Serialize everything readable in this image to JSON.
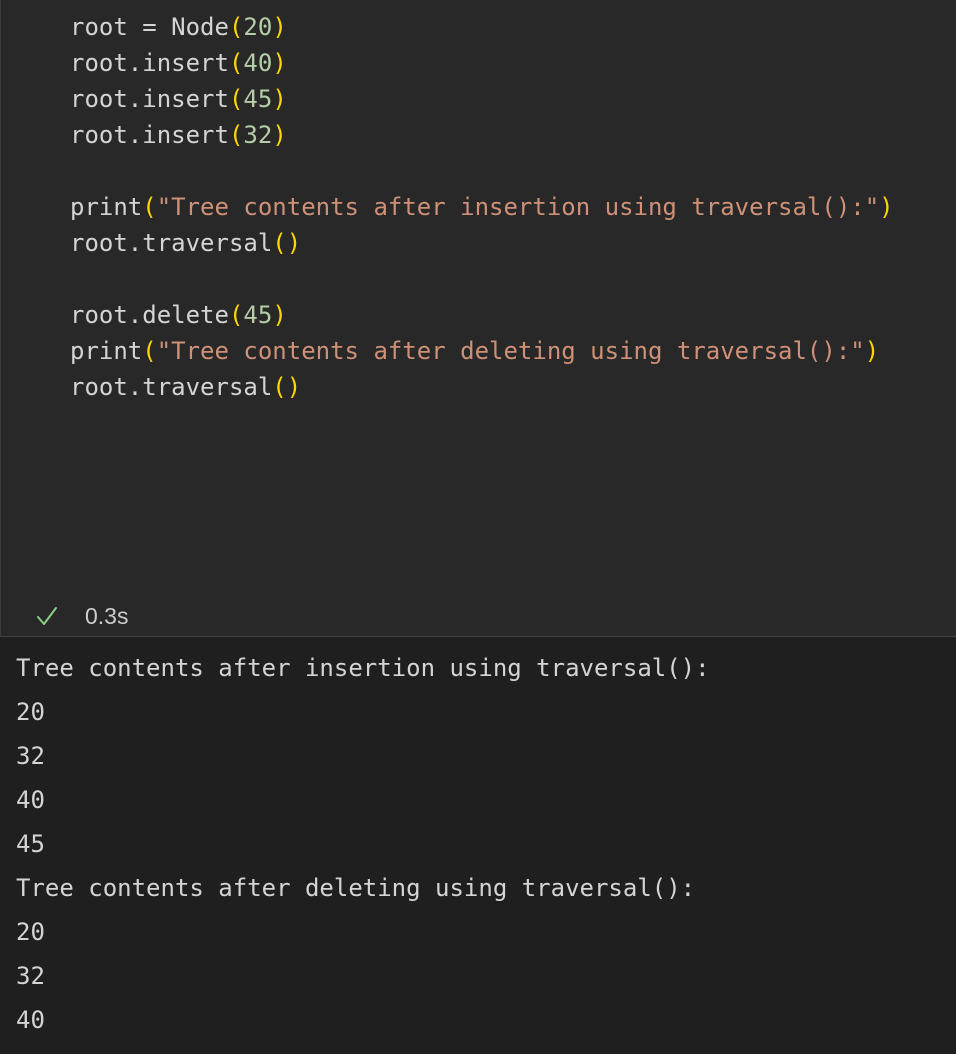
{
  "code_cell": {
    "lines": [
      [
        {
          "t": "ident",
          "v": "root = Node"
        },
        {
          "t": "paren",
          "v": "("
        },
        {
          "t": "num",
          "v": "20"
        },
        {
          "t": "paren",
          "v": ")"
        }
      ],
      [
        {
          "t": "ident",
          "v": "root.insert"
        },
        {
          "t": "paren",
          "v": "("
        },
        {
          "t": "num",
          "v": "40"
        },
        {
          "t": "paren",
          "v": ")"
        }
      ],
      [
        {
          "t": "ident",
          "v": "root.insert"
        },
        {
          "t": "paren",
          "v": "("
        },
        {
          "t": "num",
          "v": "45"
        },
        {
          "t": "paren",
          "v": ")"
        }
      ],
      [
        {
          "t": "ident",
          "v": "root.insert"
        },
        {
          "t": "paren",
          "v": "("
        },
        {
          "t": "num",
          "v": "32"
        },
        {
          "t": "paren",
          "v": ")"
        }
      ],
      [],
      [
        {
          "t": "ident",
          "v": "print"
        },
        {
          "t": "paren",
          "v": "("
        },
        {
          "t": "str",
          "v": "\"Tree contents after insertion using traversal():\""
        },
        {
          "t": "paren",
          "v": ")"
        }
      ],
      [
        {
          "t": "ident",
          "v": "root.traversal"
        },
        {
          "t": "paren",
          "v": "()"
        }
      ],
      [],
      [
        {
          "t": "ident",
          "v": "root.delete"
        },
        {
          "t": "paren",
          "v": "("
        },
        {
          "t": "num",
          "v": "45"
        },
        {
          "t": "paren",
          "v": ")"
        }
      ],
      [
        {
          "t": "ident",
          "v": "print"
        },
        {
          "t": "paren",
          "v": "("
        },
        {
          "t": "str",
          "v": "\"Tree contents after deleting using traversal():\""
        },
        {
          "t": "paren",
          "v": ")"
        }
      ],
      [
        {
          "t": "ident",
          "v": "root.traversal"
        },
        {
          "t": "paren",
          "v": "()"
        }
      ]
    ]
  },
  "status": {
    "icon": "check-icon",
    "time": "0.3s",
    "success_color": "#89d185"
  },
  "output": {
    "lines": [
      "Tree contents after insertion using traversal():",
      "20",
      "32",
      "40",
      "45",
      "Tree contents after deleting using traversal():",
      "20",
      "32",
      "40"
    ]
  },
  "colors": {
    "ident": "#d4d4d4",
    "paren": "#ffd700",
    "number": "#b5cea8",
    "string": "#ce9178",
    "cell_bg": "#282828",
    "output_bg": "#1f1f1f"
  }
}
